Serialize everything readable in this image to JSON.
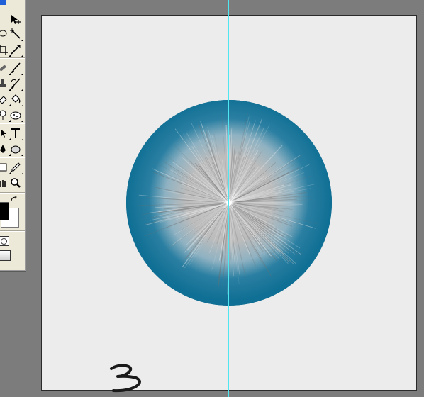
{
  "toolbox": {
    "tools": [
      {
        "name": "move-tool",
        "icon": "move-icon"
      },
      {
        "name": "lasso-tool",
        "icon": "lasso-icon"
      },
      {
        "name": "magic-wand-tool",
        "icon": "magic-wand-icon"
      },
      {
        "name": "crop-tool",
        "icon": "crop-icon"
      },
      {
        "name": "slice-tool",
        "icon": "slice-icon"
      },
      {
        "name": "healing-brush-tool",
        "icon": "bandage-icon"
      },
      {
        "name": "brush-tool",
        "icon": "brush-icon"
      },
      {
        "name": "clone-stamp-tool",
        "icon": "stamp-icon"
      },
      {
        "name": "history-brush-tool",
        "icon": "history-brush-icon"
      },
      {
        "name": "eraser-tool",
        "icon": "eraser-icon"
      },
      {
        "name": "paint-bucket-tool",
        "icon": "paint-bucket-icon"
      },
      {
        "name": "dodge-tool",
        "icon": "dodge-icon"
      },
      {
        "name": "path-selection-tool",
        "icon": "path-selection-icon"
      },
      {
        "name": "type-tool",
        "icon": "type-icon",
        "label": "T"
      },
      {
        "name": "pen-tool",
        "icon": "pen-icon"
      },
      {
        "name": "ellipse-tool",
        "icon": "ellipse-icon"
      },
      {
        "name": "notes-tool",
        "icon": "notes-icon"
      },
      {
        "name": "eyedropper-tool",
        "icon": "eyedropper-icon"
      },
      {
        "name": "hand-tool",
        "icon": "hand-icon"
      },
      {
        "name": "zoom-tool",
        "icon": "magnifier-icon"
      }
    ],
    "foreground_color": "#000000",
    "background_color": "#ffffff"
  },
  "canvas": {
    "background_color": "#ececec",
    "circle_outer_color": "#0f6f94",
    "circle_inner_color": "#bfbfbf",
    "guide_color": "#4ee6f0",
    "step_number": "3"
  }
}
